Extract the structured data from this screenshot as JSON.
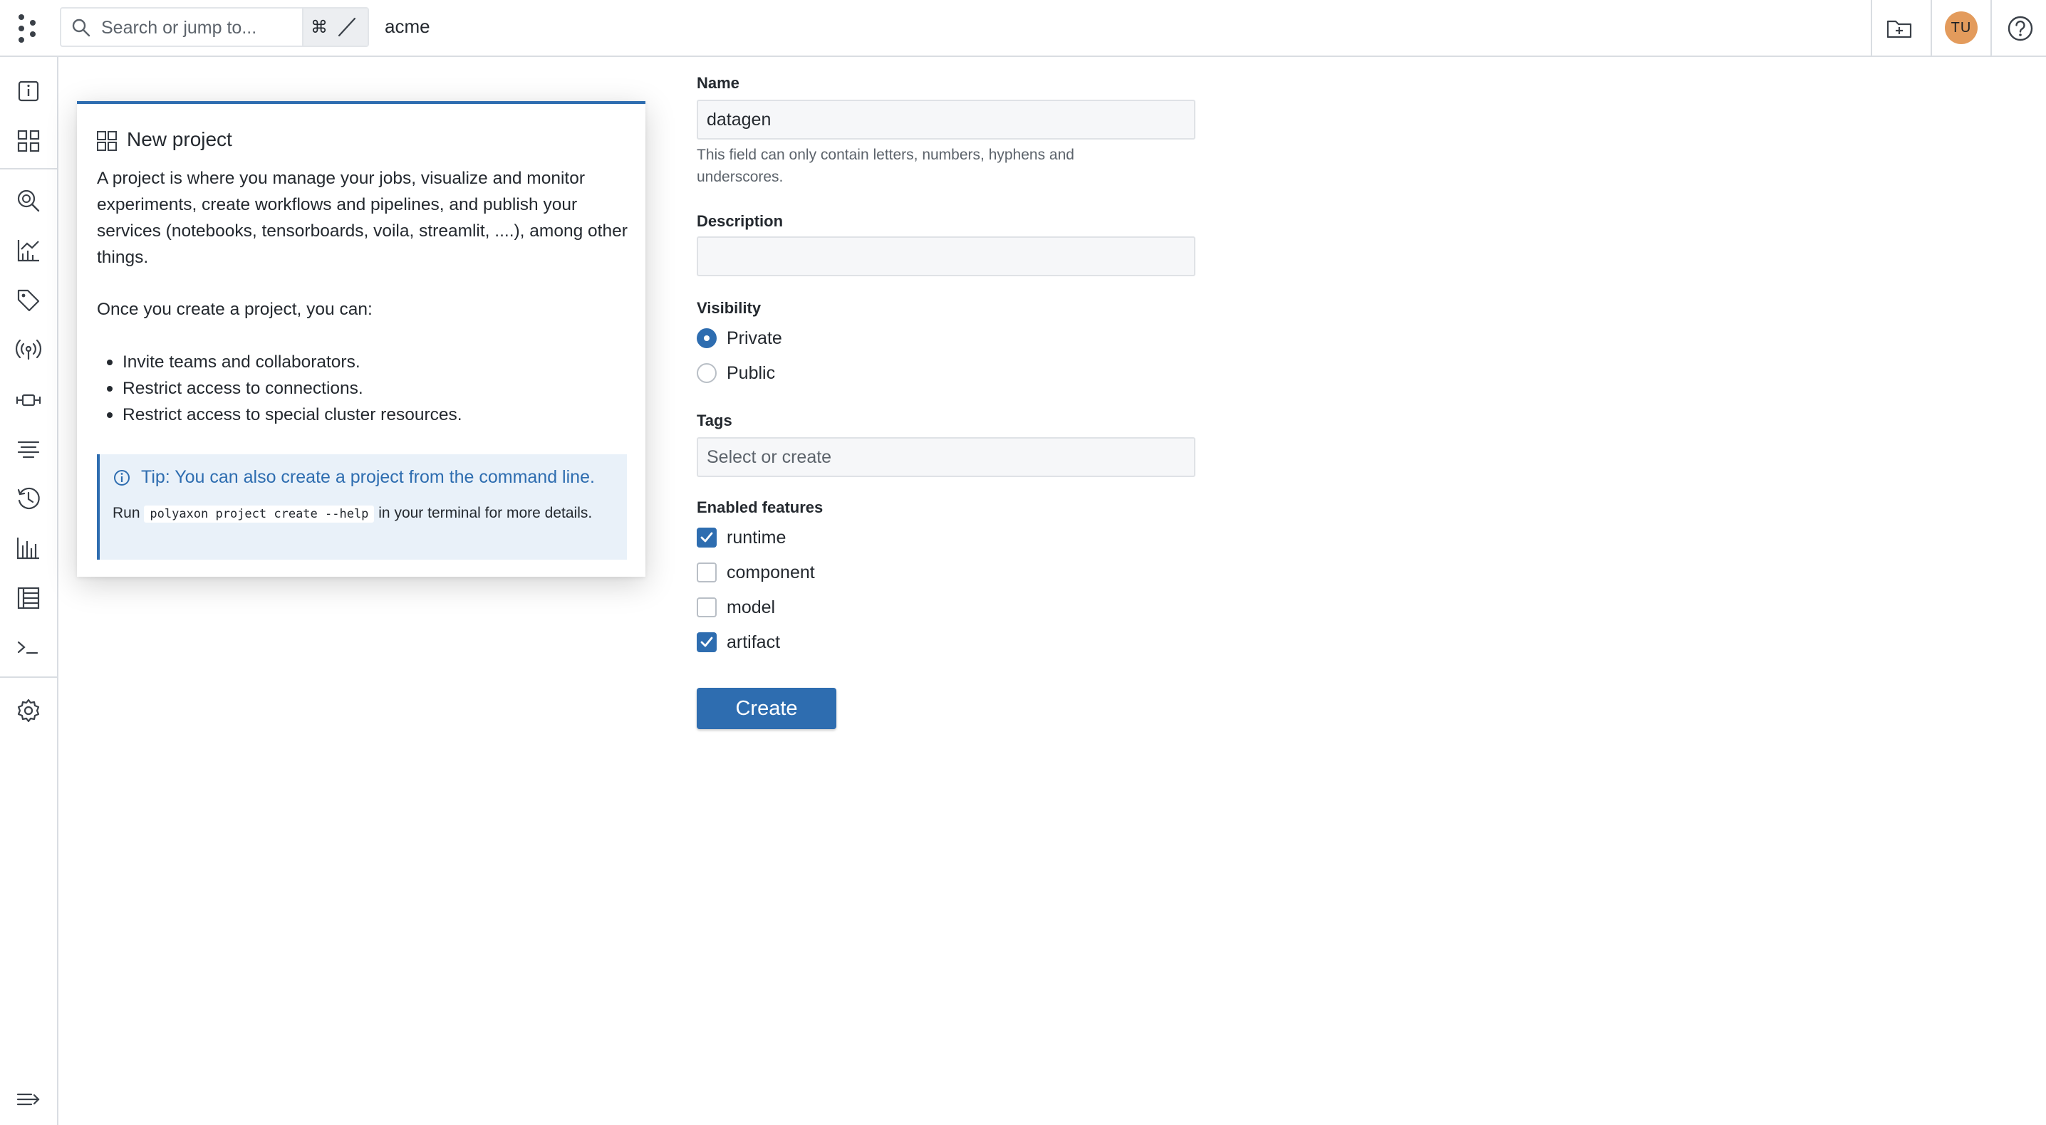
{
  "topbar": {
    "search_placeholder": "Search or jump to...",
    "shortcut_cmd": "⌘",
    "org_name": "acme",
    "avatar_initials": "TU"
  },
  "sidebar": {
    "icons": [
      "info-icon",
      "grid-icon",
      "search-icon",
      "analytics-icon",
      "tag-icon",
      "broadcast-icon",
      "component-icon",
      "filter-icon",
      "history-icon",
      "bar-chart-icon",
      "table-icon",
      "terminal-icon",
      "gear-icon",
      "expand-icon"
    ]
  },
  "info": {
    "title": "New project",
    "description": "A project is where you manage your jobs, visualize and monitor experiments, create workflows and pipelines, and publish your services (notebooks, tensorboards, voila, streamlit, ....), among other things.",
    "once_text": "Once you create a project, you can:",
    "bullets": [
      "Invite teams and collaborators.",
      "Restrict access to connections.",
      "Restrict access to special cluster resources."
    ],
    "tip_title": "Tip: You can also create a project from the command line.",
    "tip_run": "Run",
    "tip_command": "polyaxon project create --help",
    "tip_suffix": "in your terminal for more details."
  },
  "form": {
    "name_label": "Name",
    "name_value": "datagen",
    "name_help": "This field can only contain letters, numbers, hyphens and underscores.",
    "description_label": "Description",
    "description_value": "",
    "visibility_label": "Visibility",
    "visibility_options": [
      "Private",
      "Public"
    ],
    "visibility_selected": "Private",
    "tags_label": "Tags",
    "tags_placeholder": "Select or create",
    "features_label": "Enabled features",
    "features": [
      {
        "label": "runtime",
        "checked": true
      },
      {
        "label": "component",
        "checked": false
      },
      {
        "label": "model",
        "checked": false
      },
      {
        "label": "artifact",
        "checked": true
      }
    ],
    "create_label": "Create"
  },
  "colors": {
    "accent": "#2e6db0",
    "avatar": "#e39b5c",
    "tip_background": "#e9f1f9"
  }
}
